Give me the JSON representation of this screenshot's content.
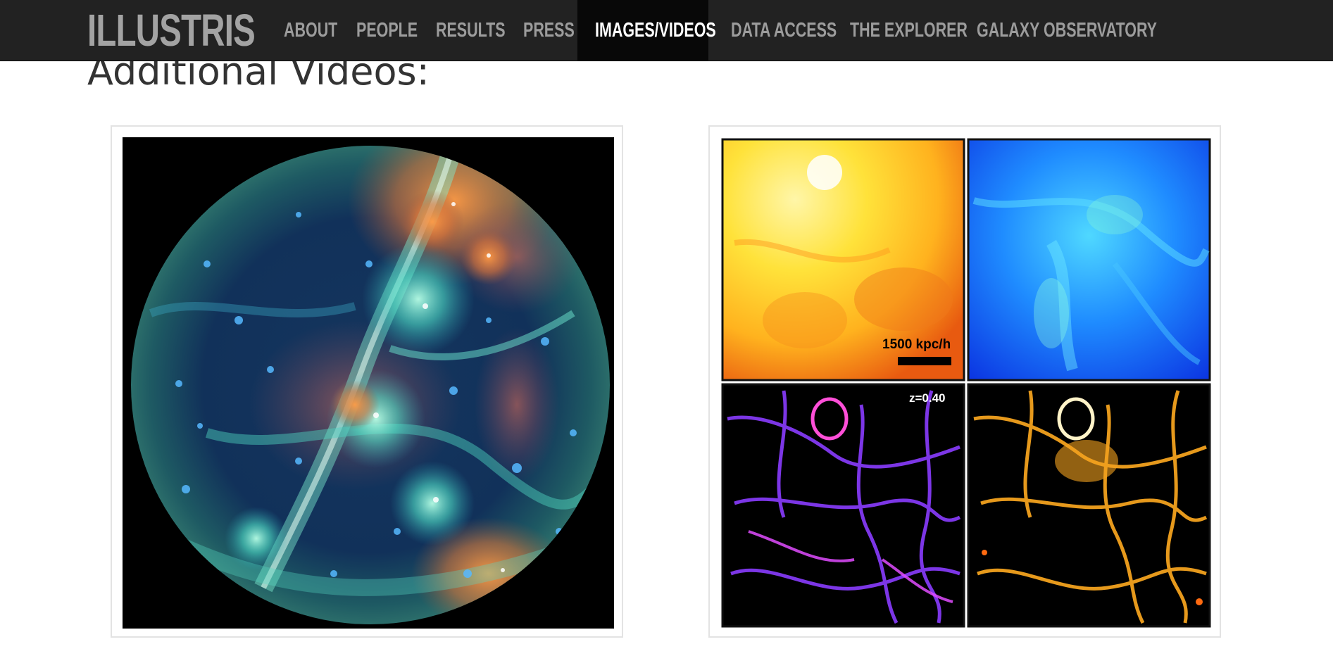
{
  "navbar": {
    "brand": "ILLUSTRIS",
    "items": [
      {
        "label": "ABOUT",
        "active": false
      },
      {
        "label": "PEOPLE",
        "active": false
      },
      {
        "label": "RESULTS",
        "active": false
      },
      {
        "label": "PRESS",
        "active": false
      },
      {
        "label": "IMAGES/VIDEOS",
        "active": true
      },
      {
        "label": "DATA ACCESS",
        "active": false
      },
      {
        "label": "THE EXPLORER",
        "active": false
      },
      {
        "label": "GALAXY OBSERVATORY",
        "active": false
      }
    ],
    "colors": {
      "background": "#222222",
      "text": "#9c9c9c",
      "active_background": "#080808",
      "active_text": "#ffffff"
    }
  },
  "main": {
    "heading": "Additional Videos:",
    "videos": [
      {
        "image": "fisheye-cosmic-web-render"
      },
      {
        "image": "four-panel-gas-maps",
        "scale_label": "1500 kpc/h",
        "redshift_label": "z=0.40"
      }
    ]
  }
}
